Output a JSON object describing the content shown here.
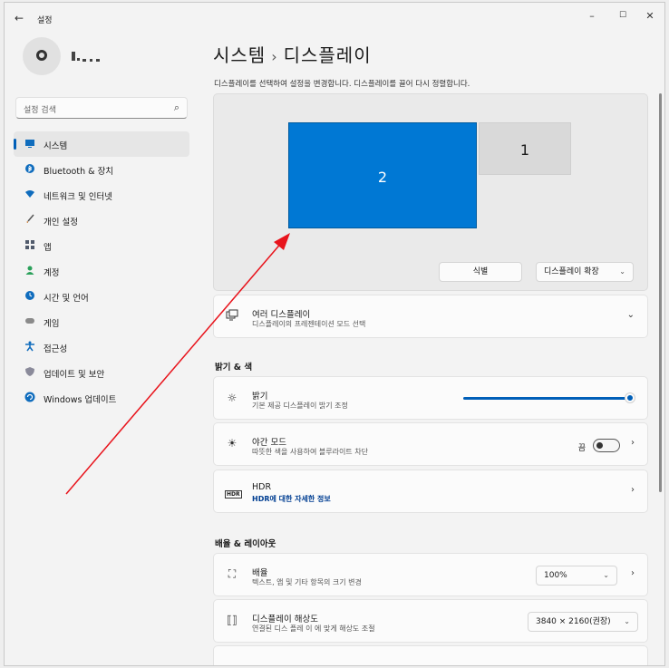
{
  "titlebar": {
    "back": "←",
    "title": "설정",
    "minimize": "–",
    "maximize": "☐",
    "close": "✕"
  },
  "sidebar": {
    "search_placeholder": "설정 검색",
    "items": [
      {
        "label": "시스템",
        "icon": "monitor-icon",
        "color": "#0f6cbd",
        "active": true
      },
      {
        "label": "Bluetooth & 장치",
        "icon": "bluetooth-icon",
        "color": "#0f6cbd"
      },
      {
        "label": "네트워크 및 인터넷",
        "icon": "wifi-icon",
        "color": "#0f6cbd"
      },
      {
        "label": "개인 설정",
        "icon": "brush-icon",
        "color": "#8a5a2b"
      },
      {
        "label": "앱",
        "icon": "apps-icon",
        "color": "#505a6b"
      },
      {
        "label": "계정",
        "icon": "person-icon",
        "color": "#2aa05a"
      },
      {
        "label": "시간 및 언어",
        "icon": "globe-clock-icon",
        "color": "#0f6cbd"
      },
      {
        "label": "게임",
        "icon": "gamepad-icon",
        "color": "#7a7a7a"
      },
      {
        "label": "접근성",
        "icon": "accessibility-icon",
        "color": "#0f6cbd"
      },
      {
        "label": "업데이트 및 보안",
        "icon": "shield-icon",
        "color": "#7a7a8a"
      },
      {
        "label": "Windows 업데이트",
        "icon": "update-icon",
        "color": "#0f6cbd"
      }
    ]
  },
  "main": {
    "breadcrumb_parent": "시스템",
    "breadcrumb_sep": "›",
    "breadcrumb_current": "디스플레이",
    "description": "디스플레이를 선택하여 설정을 변경합니다. 디스플레이를 끌어 다시 정렬합니다.",
    "monitors": [
      {
        "label": "2",
        "selected": true
      },
      {
        "label": "1",
        "selected": false
      }
    ],
    "identify_button": "식별",
    "extend_dropdown": "디스플레이 확장",
    "multi_display": {
      "title": "여러 디스플레이",
      "subtitle": "디스플레이의 프레젠테이션 모드 선택"
    },
    "brightness_section": "밝기 & 색",
    "brightness": {
      "title": "밝기",
      "subtitle": "기본 제공 디스플레이 밝기 조정",
      "value": 100
    },
    "night_mode": {
      "title": "야간 모드",
      "subtitle": "따뜻한 색을 사용하여 블루라이트 차단",
      "state": "끔"
    },
    "hdr": {
      "badge": "HDR",
      "title": "HDR",
      "link": "HDR에 대한 자세한 정보"
    },
    "layout_section": "배율 & 레이아웃",
    "scale": {
      "title": "배율",
      "subtitle": "텍스트, 앱 및 기타 항목의 크기 변경",
      "value": "100%"
    },
    "resolution": {
      "title": "디스플레이 해상도",
      "subtitle": "연결된 디스 플레 이 에 맞게 해상도 조절",
      "value": "3840 × 2160(권장)"
    }
  },
  "colors": {
    "accent": "#005fb8",
    "selected_monitor": "#0078d4",
    "annotation_arrow": "#e8141c"
  }
}
